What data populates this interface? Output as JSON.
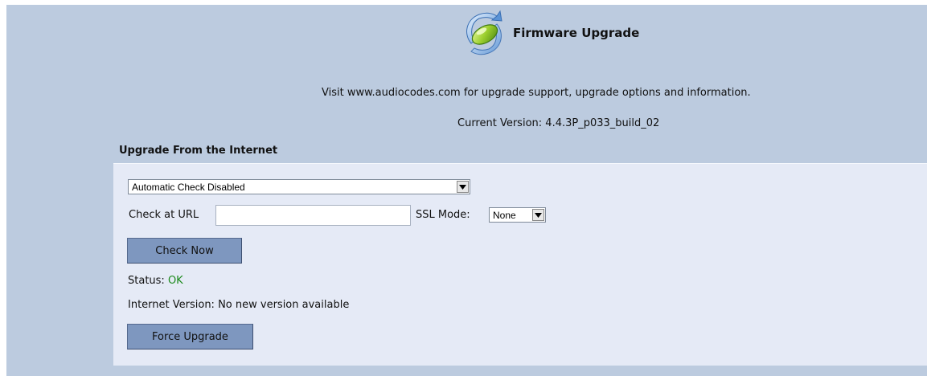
{
  "header": {
    "title": "Firmware Upgrade",
    "visit_text": "Visit www.audiocodes.com for upgrade support, upgrade options and information.",
    "current_version_label": "Current Version:",
    "current_version_value": "4.4.3P_p033_build_02"
  },
  "section": {
    "title": "Upgrade From the Internet"
  },
  "form": {
    "auto_check_selected": "Automatic Check Disabled",
    "url_label": "Check at URL",
    "url_value": "",
    "ssl_label": "SSL Mode:",
    "ssl_selected": "None",
    "check_now_label": "Check Now",
    "status_label": "Status:",
    "status_value": "OK",
    "internet_version_label": "Internet Version:",
    "internet_version_value": "No new version available",
    "force_upgrade_label": "Force Upgrade"
  },
  "colors": {
    "background": "#bccbdf",
    "panel": "#e5eaf6",
    "button": "#7e97bf",
    "status_ok": "#1c8a1c"
  },
  "icons": {
    "logo": "firmware-upgrade-icon",
    "dropdown": "dropdown-arrow-icon"
  }
}
